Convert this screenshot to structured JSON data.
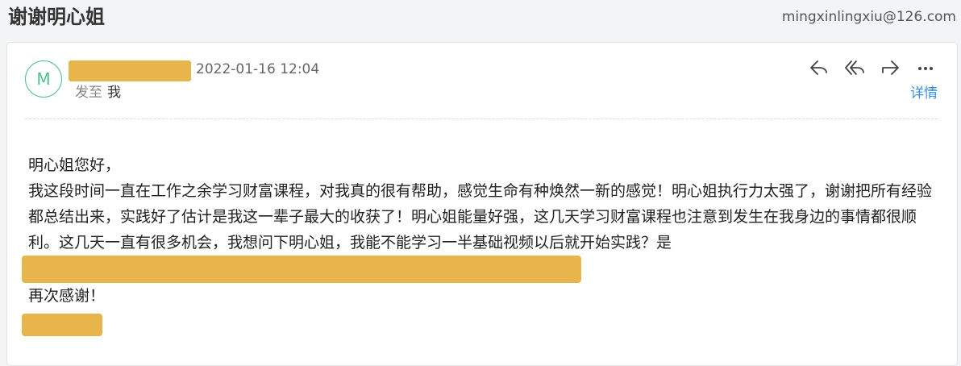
{
  "header": {
    "subject": "谢谢明心姐",
    "from_address": "mingxinlingxiu@126.com"
  },
  "message": {
    "avatar_letter": "M",
    "date": "2022-01-16 12:04",
    "to_label": "发至",
    "to_value": "我",
    "details_label": "详情",
    "actions": [
      {
        "name": "reply",
        "icon": "reply-icon"
      },
      {
        "name": "reply-all",
        "icon": "reply-all-icon"
      },
      {
        "name": "forward",
        "icon": "forward-icon"
      },
      {
        "name": "more",
        "icon": "more-icon"
      }
    ],
    "body": {
      "greeting": "明心姐您好，",
      "paragraph": "我这段时间一直在工作之余学习财富课程，对我真的很有帮助，感觉生命有种焕然一新的感觉！明心姐执行力太强了，谢谢把所有经验都总结出来，实践好了估计是我这一辈子最大的收获了！明心姐能量好强，这几天学习财富课程也注意到发生在我身边的事情都很顺利。这几天一直有很多机会，我想问下明心姐，我能不能学习一半基础视频以后就开始实践？是",
      "closing": "再次感谢！"
    }
  },
  "colors": {
    "accent_link": "#3a8ee6",
    "avatar": "#4fbf8e",
    "redaction": "#e8b44c"
  }
}
